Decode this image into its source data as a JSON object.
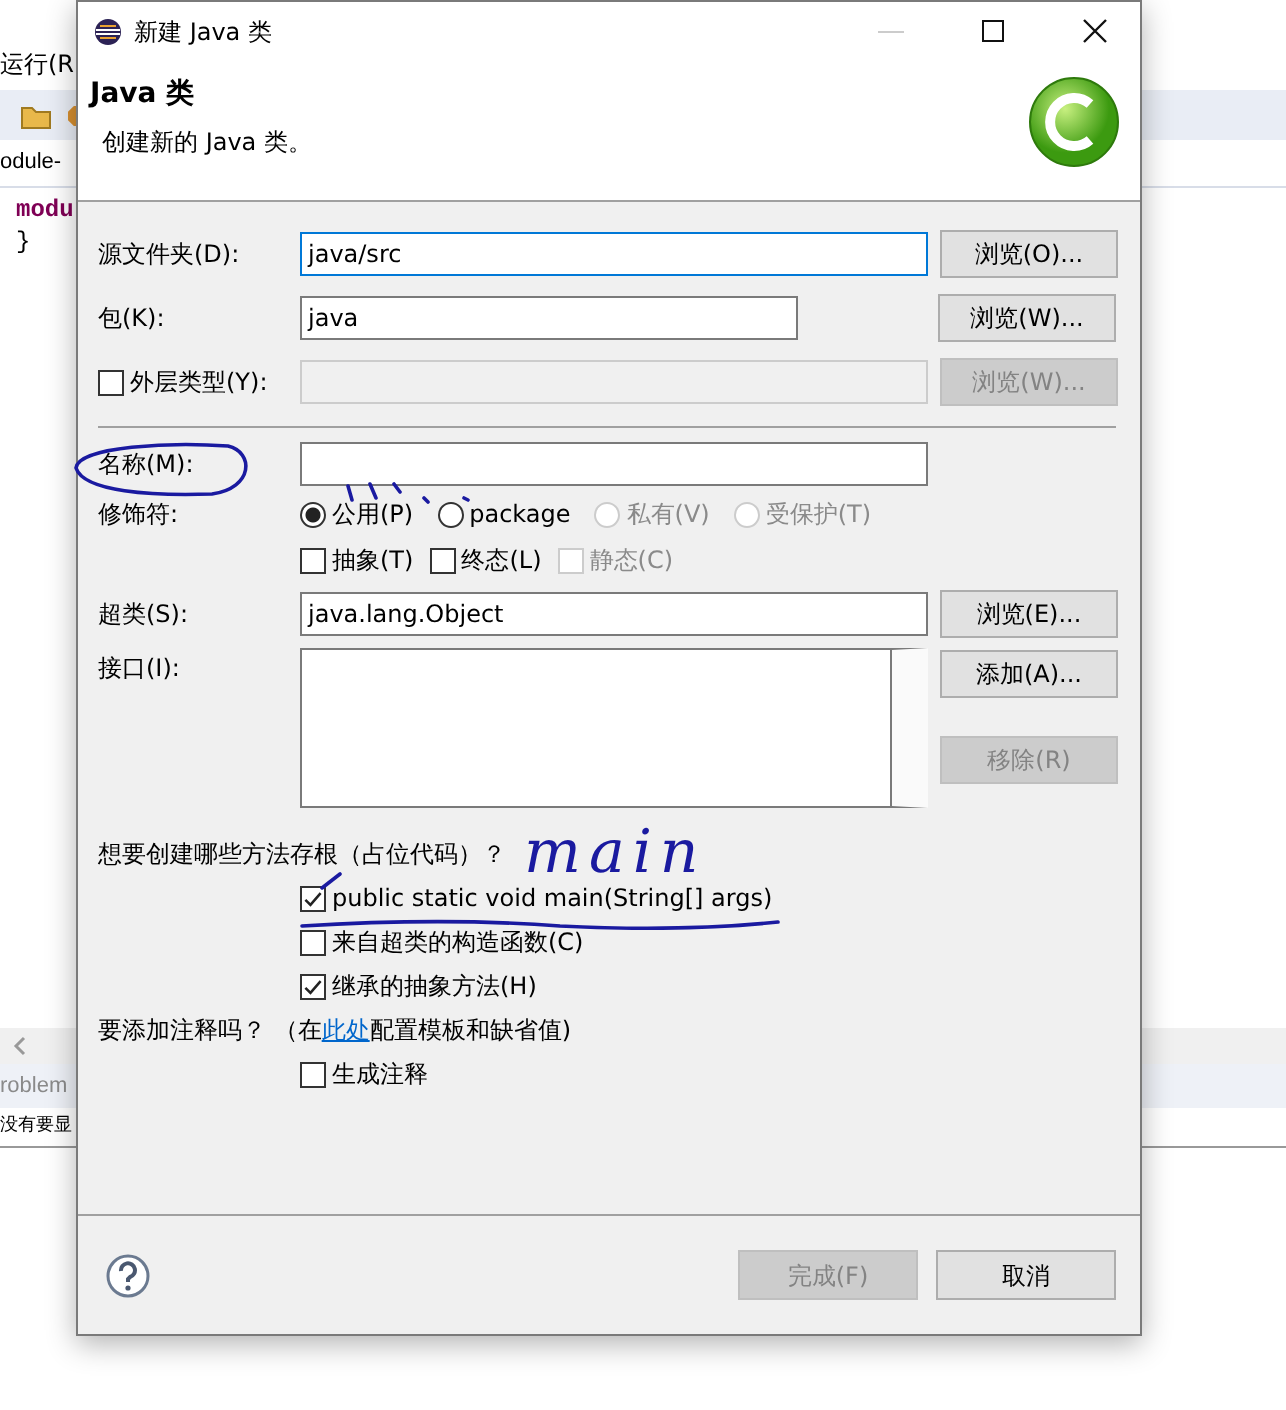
{
  "background_ide": {
    "menu_fragment": "运行(R",
    "editor_tab": "odule-",
    "code_lines": [
      "modu",
      "}"
    ],
    "problems_tab": "roblem",
    "problems_message": "没有要显"
  },
  "dialog": {
    "title": "新建 Java 类",
    "header": {
      "title": "Java 类",
      "description": "创建新的 Java 类。"
    },
    "fields": [
      {
        "kind": "text",
        "label": "源文件夹(D):",
        "value": "java/src",
        "focused": true,
        "disabled": false,
        "button": {
          "label": "浏览(O)...",
          "disabled": false
        }
      },
      {
        "kind": "text",
        "label": "包(K):",
        "value": "java",
        "focused": false,
        "disabled": false,
        "button": {
          "label": "浏览(W)...",
          "disabled": false
        }
      },
      {
        "kind": "checkbox",
        "label": "外层类型(Y):",
        "checked": false,
        "focused": false,
        "disabled": true,
        "button": {
          "label": "浏览(W)...",
          "disabled": true
        }
      }
    ],
    "name_field": {
      "label": "名称(M):"
    },
    "modifiers": {
      "label": "修饰符:",
      "access": [
        {
          "label": "公用(P)",
          "selected": true,
          "disabled": false
        },
        {
          "label": "package",
          "selected": false,
          "disabled": false
        },
        {
          "label": "私有(V)",
          "selected": false,
          "disabled": true
        },
        {
          "label": "受保护(T)",
          "selected": false,
          "disabled": true
        }
      ],
      "flags": [
        {
          "label": "抽象(T)",
          "checked": false,
          "disabled": false
        },
        {
          "label": "终态(L)",
          "checked": false,
          "disabled": false
        },
        {
          "label": "静态(C)",
          "checked": false,
          "disabled": true
        }
      ]
    },
    "superclass": {
      "label": "超类(S):",
      "value": "java.lang.Object",
      "button": {
        "label": "浏览(E)...",
        "disabled": false
      }
    },
    "interfaces": {
      "label": "接口(I):",
      "buttons": [
        {
          "label": "添加(A)...",
          "disabled": false
        },
        {
          "label": "移除(R)",
          "disabled": true
        }
      ]
    },
    "stubs": {
      "question": "想要创建哪些方法存根（占位代码）？",
      "options": [
        {
          "label": "public static void main(String[] args)",
          "checked": true
        },
        {
          "label": "来自超类的构造函数(C)",
          "checked": false
        },
        {
          "label": "继承的抽象方法(H)",
          "checked": true
        }
      ]
    },
    "comments": {
      "question_before": "要添加注释吗？ （在",
      "link": "此处",
      "question_after": "配置模板和缺省值)",
      "options": [
        {
          "label": "生成注释",
          "checked": false
        }
      ]
    },
    "buttons": [
      {
        "label": "完成(F)",
        "disabled": true
      },
      {
        "label": "取消",
        "disabled": false
      }
    ]
  },
  "annotation": {
    "text": "main"
  }
}
